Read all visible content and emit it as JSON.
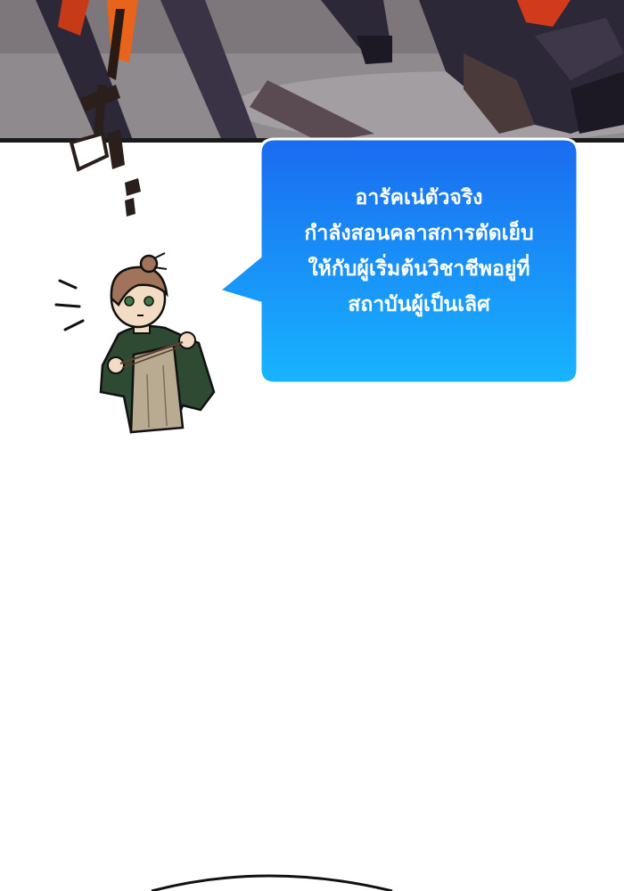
{
  "speech_bubble": {
    "lines": [
      "อารัคเน่ตัวจริง",
      "กำลังสอนคลาสการตัดเย็บ",
      "ให้กับผู้เริ่มต้นวิชาชีพอยู่ที่",
      "สถาบันผู้เป็นเลิศ"
    ],
    "fill_top": "#1a6bf0",
    "fill_bottom": "#18b4ff"
  },
  "colors": {
    "panel_background": "#8f8a8d",
    "panel_border": "#1a1a1a",
    "creature": "#2d2838",
    "accent_red": "#d23a1c",
    "coat": "#2f4a32",
    "apron": "#b9aa92"
  }
}
